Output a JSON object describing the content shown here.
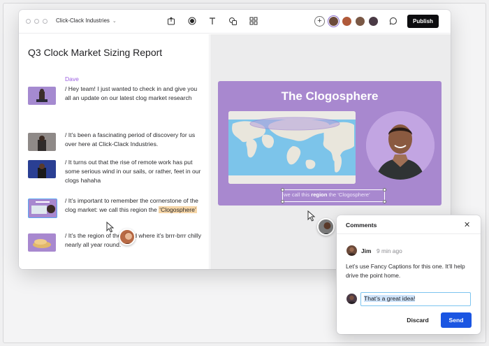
{
  "toolbar": {
    "company": "Click-Clack Industries",
    "publish_label": "Publish",
    "add_label": "+"
  },
  "document": {
    "title": "Q3 Clock Market Sizing Report",
    "speaker": "Dave",
    "paragraphs": [
      {
        "text": "/ Hey team! I just wanted to check in and give you all an update on our latest clog market research"
      },
      {
        "text": "/ It’s been a fascinating period of discovery for us over here at Click-Clack Industries."
      },
      {
        "text": "/ It turns out that the rise of remote work has put some serious wind in our sails, or rather, feet in our clogs hahaha"
      },
      {
        "text_before": "/ It’s important to remember the cornerstone of the clog market: we call this region the ",
        "highlight": "‘Clogosphere’"
      },
      {
        "text": "/ It’s the region of the world where it’s brrr-brrr chilly nearly all year round."
      }
    ]
  },
  "slide": {
    "title": "The Clogosphere",
    "caption_pre": "we call this ",
    "caption_bold": "region",
    "caption_post": " the ‘Clogosphere’"
  },
  "comments": {
    "title": "Comments",
    "close": "✕",
    "author": "Jim",
    "time": "9 min ago",
    "body": "Let’s use Fancy Captions for this one. It’ll help drive the point home.",
    "reply_value": "That’s a great idea!",
    "discard_label": "Discard",
    "send_label": "Send"
  },
  "colors": {
    "accent": "#1a55e2",
    "slide_bg": "#a888cf",
    "speaker": "#9a5de0",
    "highlight": "#f6d6a8"
  }
}
